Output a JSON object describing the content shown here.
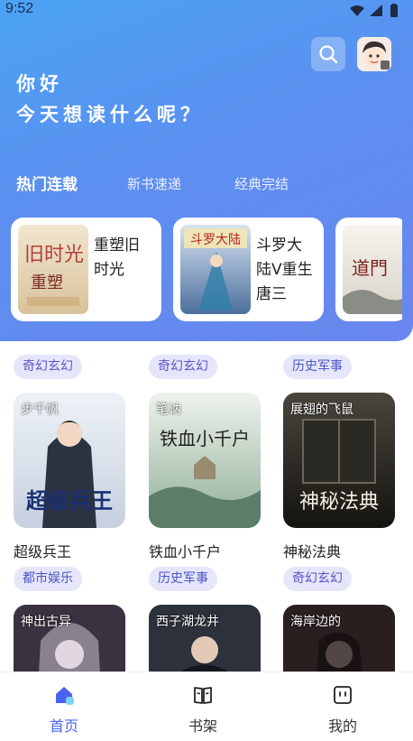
{
  "status_bar": {
    "time": "9:52"
  },
  "greeting": {
    "line1": "你好",
    "line2": "今天想读什么呢？"
  },
  "tabs": [
    {
      "label": "热门连载",
      "active": true
    },
    {
      "label": "新书速递",
      "active": false
    },
    {
      "label": "经典完结",
      "active": false
    }
  ],
  "featured": [
    {
      "title": "重塑旧时光",
      "cover_text": "旧时光",
      "cover_subtext": "重塑"
    },
    {
      "title": "斗罗大陆V重生唐三",
      "cover_text": "斗罗大陆"
    },
    {
      "title": "",
      "cover_text": "道門"
    }
  ],
  "partial_row_tags": [
    "奇幻玄幻",
    "奇幻玄幻",
    "历史军事"
  ],
  "books": [
    {
      "title": "超级兵王",
      "author": "步千帆",
      "cover_text": "超级兵王",
      "tag": "都市娱乐",
      "cover_colors": [
        "#e9eef5",
        "#c9d3e2"
      ]
    },
    {
      "title": "铁血小千户",
      "author": "笔讷",
      "cover_text": "铁血小千户",
      "tag": "历史军事",
      "cover_colors": [
        "#e9f0e8",
        "#9fb6a4"
      ]
    },
    {
      "title": "神秘法典",
      "author": "展翅的飞鼠",
      "cover_text": "神秘法典",
      "tag": "奇幻玄幻",
      "cover_colors": [
        "#3b3a36",
        "#14130f"
      ]
    }
  ],
  "bottom_books": [
    {
      "author": "神出古异",
      "cover_colors": [
        "#2a2230",
        "#6d6577"
      ]
    },
    {
      "author": "西子湖龙井",
      "cover_colors": [
        "#2f3440",
        "#0f1117"
      ]
    },
    {
      "author": "海岸边的",
      "cover_colors": [
        "#3a2b2b",
        "#111"
      ]
    }
  ],
  "nav": [
    {
      "label": "首页",
      "icon": "home-icon",
      "active": true
    },
    {
      "label": "书架",
      "icon": "book-open-icon",
      "active": false
    },
    {
      "label": "我的",
      "icon": "profile-icon",
      "active": false
    }
  ],
  "colors": {
    "accent": "#4a63ee",
    "tag_bg": "#e6e6fa",
    "header_start": "#4aa3f4",
    "header_end": "#6a86ee"
  }
}
